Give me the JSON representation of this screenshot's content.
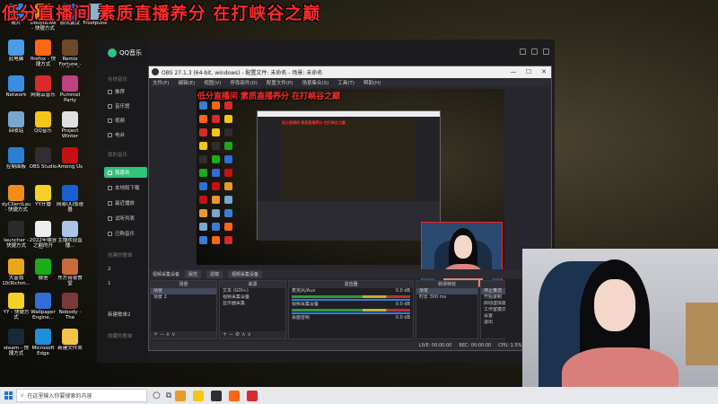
{
  "overlay": {
    "title": "低分直播间 素质直播养分  在打峡谷之巅"
  },
  "desktop_icons": [
    {
      "label": "纸片",
      "color": "#3b7dd8"
    },
    {
      "label": "DouyuLive - 快捷方式",
      "color": "#ff7a00"
    },
    {
      "label": "腾讯会议",
      "color": "#2a6cf0"
    },
    {
      "label": "Frostpunk",
      "color": "#8fb0c8"
    },
    {
      "label": "此电脑",
      "color": "#4a9be8"
    },
    {
      "label": "firefox - 快捷方式",
      "color": "#ff6611"
    },
    {
      "label": "Remix Fortune - 快捷方式",
      "color": "#6b4a2a"
    },
    {
      "label": "Network",
      "color": "#3b8de0"
    },
    {
      "label": "网易云音乐",
      "color": "#d82a2a"
    },
    {
      "label": "Pummel Party",
      "color": "#c04080"
    },
    {
      "label": "回收站",
      "color": "#7aa6cf"
    },
    {
      "label": "QQ音乐",
      "color": "#f5c518"
    },
    {
      "label": "Project Winter",
      "color": "#e0e0e0"
    },
    {
      "label": "控制面板",
      "color": "#2a7fd0"
    },
    {
      "label": "OBS Studio",
      "color": "#302e31"
    },
    {
      "label": "Among Us",
      "color": "#c51111"
    },
    {
      "label": "dyClientLau... - 快捷方式",
      "color": "#f08c1a"
    },
    {
      "label": "YY开播",
      "color": "#f5d028"
    },
    {
      "label": "网易UU加速器",
      "color": "#1a5fcf"
    },
    {
      "label": "launcher - 快捷方式",
      "color": "#2b2b2b"
    },
    {
      "label": "2022年峡谷之巅的开播...",
      "color": "#eeeeee"
    },
    {
      "label": "主播欢迎直播...",
      "color": "#a9c5e8"
    },
    {
      "label": "大富翁10(Richm...",
      "color": "#e8a81a"
    },
    {
      "label": "微信",
      "color": "#1aad19"
    },
    {
      "label": "东方宵夜食堂",
      "color": "#c96a3a"
    },
    {
      "label": "YY - 快捷方式",
      "color": "#f5d028"
    },
    {
      "label": "Wallpaper Engine...",
      "color": "#2f6fd6"
    },
    {
      "label": "Nobody - The Turnaro...",
      "color": "#7a3a3a"
    },
    {
      "label": "steam - 快捷方式",
      "color": "#1b2838"
    },
    {
      "label": "Microsoft Edge",
      "color": "#1f8fd8"
    },
    {
      "label": "新建文件夹",
      "color": "#f3c34a"
    }
  ],
  "qqmusic": {
    "app_name": "QQ音乐",
    "section_online": "在线音乐",
    "nav_items": [
      "推荐",
      "音乐馆",
      "视频",
      "电台"
    ],
    "section_mine": "我的音乐",
    "mine_items": [
      "我喜欢",
      "本地和下载",
      "最近播放",
      "试听列表",
      "已购音乐"
    ],
    "section_created": "创建的歌单",
    "created_items": [
      "2",
      "1",
      "新建歌单2"
    ],
    "section_collected": "收藏的歌单",
    "active_item": "我喜欢"
  },
  "obs": {
    "title": "OBS 27.1.3 (64-bit, windows) - 配置文件: 未命名 - 场景: 未命名",
    "menu": [
      "文件(F)",
      "编辑(E)",
      "视图(V)",
      "停靠部件(D)",
      "配置文件(P)",
      "场景集合(S)",
      "工具(T)",
      "帮助(H)"
    ],
    "source_bar": {
      "label": "视频采集设备",
      "props": "属性",
      "filters": "滤镜",
      "device": "视频采集设备"
    },
    "docks": {
      "scenes": {
        "title": "场景",
        "items": [
          "场景",
          "场景 2"
        ]
      },
      "sources": {
        "title": "来源",
        "items": [
          "文本 (GDI+)",
          "视频采集设备",
          "显示器采集"
        ]
      },
      "mixer": {
        "title": "混音器",
        "tracks": [
          {
            "name": "麦克风/Aux",
            "db": "0.0 dB"
          },
          {
            "name": "视频采集设备",
            "db": "0.0 dB"
          },
          {
            "name": "桌面音频",
            "db": "0.0 dB"
          }
        ]
      },
      "transitions": {
        "title": "转场特效",
        "type": "渐变",
        "duration_label": "时长",
        "duration": "300 ms"
      },
      "controls": {
        "title": "控件",
        "buttons": [
          "停止推流",
          "开始录制",
          "启动虚拟摄像机",
          "工作室模式",
          "设置",
          "退出"
        ]
      }
    },
    "status": {
      "live": "LIVE: 00:00:00",
      "rec": "REC: 00:00:00",
      "cpu": "CPU: 1.5%, 60.00 fps"
    }
  },
  "taskbar": {
    "search_placeholder": "在这里输入你要搜索的内容"
  }
}
